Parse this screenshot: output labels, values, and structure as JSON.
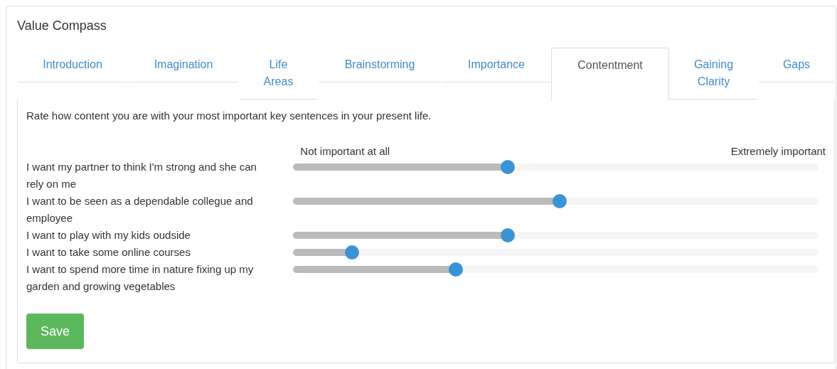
{
  "title": "Value Compass",
  "tabs": [
    {
      "label": "Introduction",
      "selected": false
    },
    {
      "label": "Imagination",
      "selected": false
    },
    {
      "label": "Life Areas",
      "selected": false
    },
    {
      "label": "Brainstorming",
      "selected": false
    },
    {
      "label": "Importance",
      "selected": false
    },
    {
      "label": "Contentment",
      "selected": true
    },
    {
      "label": "Gaining Clarity",
      "selected": false
    },
    {
      "label": "Gaps",
      "selected": false
    }
  ],
  "instruction": "Rate how content you are with your most important key sentences in your present life.",
  "scale": {
    "min_label": "Not important at all",
    "max_label": "Extremely important"
  },
  "sentences": [
    {
      "text": "I want my partner to think I'm strong and she can rely on me",
      "level": 0.4
    },
    {
      "text": "I want to be seen as a dependable collegue and employee",
      "level": 0.5
    },
    {
      "text": "I want to play with my kids oudside",
      "level": 0.4
    },
    {
      "text": "I want to take some online courses",
      "level": 0.1
    },
    {
      "text": "I want to spend more time in nature fixing up my garden and growing vegetables",
      "level": 0.3
    }
  ],
  "save_button": "Save"
}
